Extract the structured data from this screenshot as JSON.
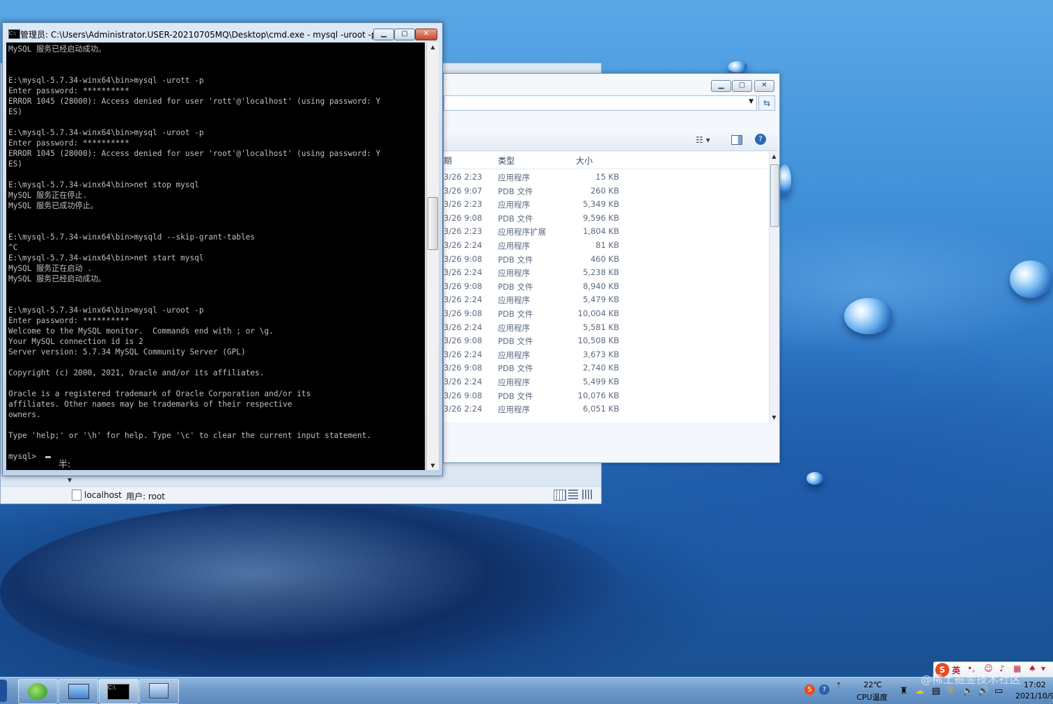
{
  "cmd": {
    "title": "管理员: C:\\Users\\Administrator.USER-20210705MQ\\Desktop\\cmd.exe - mysql  -uroot -p",
    "lines": [
      "MySQL 服务已经启动成功。",
      "",
      "",
      "E:\\mysql-5.7.34-winx64\\bin>mysql -urott -p",
      "Enter password: **********",
      "ERROR 1045 (28000): Access denied for user 'rott'@'localhost' (using password: Y",
      "ES)",
      "",
      "E:\\mysql-5.7.34-winx64\\bin>mysql -uroot -p",
      "Enter password: **********",
      "ERROR 1045 (28000): Access denied for user 'root'@'localhost' (using password: Y",
      "ES)",
      "",
      "E:\\mysql-5.7.34-winx64\\bin>net stop mysql",
      "MySQL 服务正在停止.",
      "MySQL 服务已成功停止。",
      "",
      "",
      "E:\\mysql-5.7.34-winx64\\bin>mysqld --skip-grant-tables",
      "^C",
      "E:\\mysql-5.7.34-winx64\\bin>net start mysql",
      "MySQL 服务正在启动 .",
      "MySQL 服务已经启动成功。",
      "",
      "",
      "E:\\mysql-5.7.34-winx64\\bin>mysql -uroot -p",
      "Enter password: **********",
      "Welcome to the MySQL monitor.  Commands end with ; or \\g.",
      "Your MySQL connection id is 2",
      "Server version: 5.7.34 MySQL Community Server (GPL)",
      "",
      "Copyright (c) 2000, 2021, Oracle and/or its affiliates.",
      "",
      "Oracle is a registered trademark of Oracle Corporation and/or its",
      "affiliates. Other names may be trademarks of their respective",
      "owners.",
      "",
      "Type 'help;' or '\\h' for help. Type '\\c' to clear the current input statement.",
      "",
      "mysql> "
    ],
    "ime_indicator": "半:"
  },
  "explorer": {
    "headers": {
      "date": "期",
      "type": "类型",
      "size": "大小"
    },
    "rows": [
      {
        "date": "3/26 2:23",
        "type": "应用程序",
        "size": "15 KB"
      },
      {
        "date": "3/26 9:07",
        "type": "PDB 文件",
        "size": "260 KB"
      },
      {
        "date": "3/26 2:23",
        "type": "应用程序",
        "size": "5,349 KB"
      },
      {
        "date": "3/26 9:08",
        "type": "PDB 文件",
        "size": "9,596 KB"
      },
      {
        "date": "3/26 2:23",
        "type": "应用程序扩展",
        "size": "1,804 KB"
      },
      {
        "date": "3/26 2:24",
        "type": "应用程序",
        "size": "81 KB"
      },
      {
        "date": "3/26 9:08",
        "type": "PDB 文件",
        "size": "460 KB"
      },
      {
        "date": "3/26 2:24",
        "type": "应用程序",
        "size": "5,238 KB"
      },
      {
        "date": "3/26 9:08",
        "type": "PDB 文件",
        "size": "8,940 KB"
      },
      {
        "date": "3/26 2:24",
        "type": "应用程序",
        "size": "5,479 KB"
      },
      {
        "date": "3/26 9:08",
        "type": "PDB 文件",
        "size": "10,004 KB"
      },
      {
        "date": "3/26 2:24",
        "type": "应用程序",
        "size": "5,581 KB"
      },
      {
        "date": "3/26 9:08",
        "type": "PDB 文件",
        "size": "10,508 KB"
      },
      {
        "date": "3/26 2:24",
        "type": "应用程序",
        "size": "3,673 KB"
      },
      {
        "date": "3/26 9:08",
        "type": "PDB 文件",
        "size": "2,740 KB"
      },
      {
        "date": "3/26 2:24",
        "type": "应用程序",
        "size": "5,499 KB"
      },
      {
        "date": "3/26 9:08",
        "type": "PDB 文件",
        "size": "10,076 KB"
      },
      {
        "date": "3/26 2:24",
        "type": "应用程序",
        "size": "6,051 KB"
      }
    ]
  },
  "navicat": {
    "host": "localhost",
    "user": "用户: root"
  },
  "taskbar": {
    "cpu_temp": "22℃",
    "cpu_label": "CPU温度",
    "time": "17:02",
    "date": "2021/10/9",
    "ime_lang": "英",
    "watermark": "@稀土掘金技术社区"
  },
  "colors": {
    "console_bg": "#000000",
    "console_fg": "#c0c0c0",
    "accent": "#2a72c0"
  }
}
